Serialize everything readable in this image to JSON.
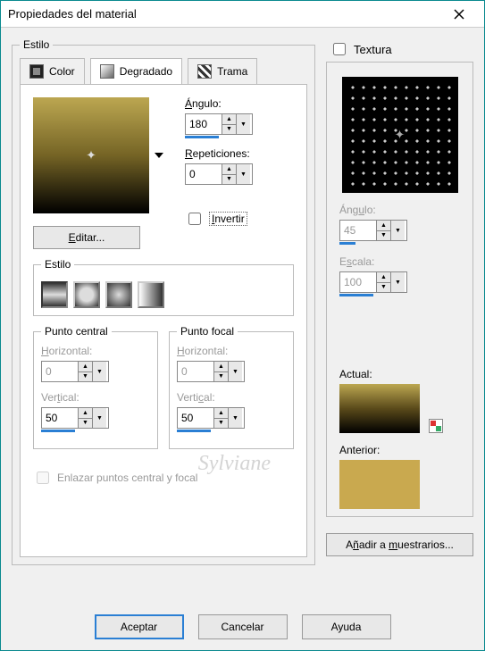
{
  "window": {
    "title": "Propiedades del material"
  },
  "style_group": {
    "label": "Estilo",
    "tabs": {
      "color": "Color",
      "gradient": "Degradado",
      "pattern": "Trama"
    }
  },
  "gradient": {
    "edit_btn": "Editar...",
    "angle_label": "Ángulo:",
    "angle_value": "180",
    "reps_label": "Repeticiones:",
    "reps_value": "0",
    "invert_label": "Invertir",
    "style_label": "Estilo"
  },
  "central": {
    "group": "Punto central",
    "h_label": "Horizontal:",
    "h_value": "0",
    "v_label": "Vertical:",
    "v_value": "50"
  },
  "focal": {
    "group": "Punto focal",
    "h_label": "Horizontal:",
    "h_value": "0",
    "v_label": "Vertical:",
    "v_value": "50"
  },
  "link_points": "Enlazar puntos central y focal",
  "texture": {
    "label": "Textura",
    "angle_label": "Ángulo:",
    "angle_value": "45",
    "scale_label": "Escala:",
    "scale_value": "100",
    "current_label": "Actual:",
    "prev_label": "Anterior:",
    "add_btn": "Añadir a muestrarios..."
  },
  "buttons": {
    "ok": "Aceptar",
    "cancel": "Cancelar",
    "help": "Ayuda"
  },
  "colors": {
    "current_grad_top": "#bca751",
    "previous": "#c9a94f"
  },
  "watermark": "Sylviane"
}
